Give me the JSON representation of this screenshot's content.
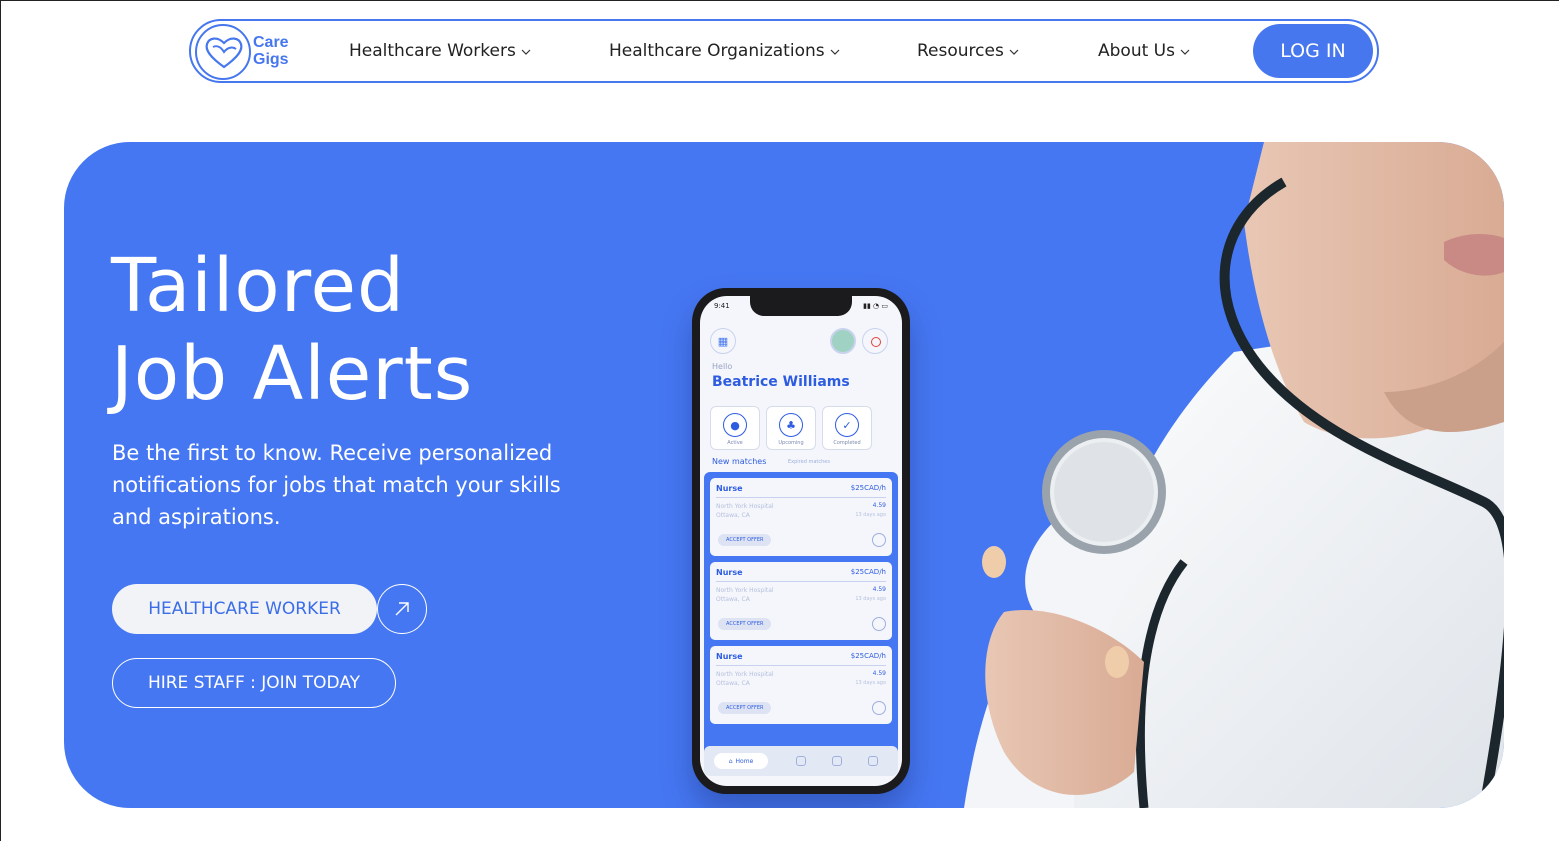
{
  "brand": {
    "line1": "Care",
    "line2": "Gigs"
  },
  "nav": {
    "items": [
      {
        "label": "Healthcare Workers"
      },
      {
        "label": "Healthcare Organizations"
      },
      {
        "label": "Resources"
      },
      {
        "label": "About Us"
      }
    ],
    "login_label": "LOG IN"
  },
  "hero": {
    "title_line1": "Tailored",
    "title_line2": "Job Alerts",
    "subtitle": "Be the first to know. Receive personalized notifications for jobs that match your skills and aspirations.",
    "primary_button": "HEALTHCARE WORKER",
    "secondary_button": "HIRE STAFF : JOIN TODAY"
  },
  "phone": {
    "time": "9:41",
    "greeting": "Hello",
    "user_name": "Beatrice Williams",
    "tiles": [
      {
        "label": "Active"
      },
      {
        "label": "Upcoming"
      },
      {
        "label": "Completed"
      }
    ],
    "new_matches_label": "New matches",
    "expired_label": "Expired matches",
    "jobs": [
      {
        "title": "Nurse",
        "pay": "$25CAD/h",
        "hospital": "North York Hospital",
        "city": "Ottawa, CA",
        "rating": "4.59",
        "ago": "13 days ago",
        "button": "ACCEPT OFFER"
      },
      {
        "title": "Nurse",
        "pay": "$25CAD/h",
        "hospital": "North York Hospital",
        "city": "Ottawa, CA",
        "rating": "4.59",
        "ago": "13 days ago",
        "button": "ACCEPT OFFER"
      },
      {
        "title": "Nurse",
        "pay": "$25CAD/h",
        "hospital": "North York Hospital",
        "city": "Ottawa, CA",
        "rating": "4.59",
        "ago": "13 days ago",
        "button": "ACCEPT OFFER"
      }
    ],
    "tab_home": "Home"
  },
  "colors": {
    "brand_blue": "#4677ef",
    "hero_blue": "#4677f2"
  }
}
